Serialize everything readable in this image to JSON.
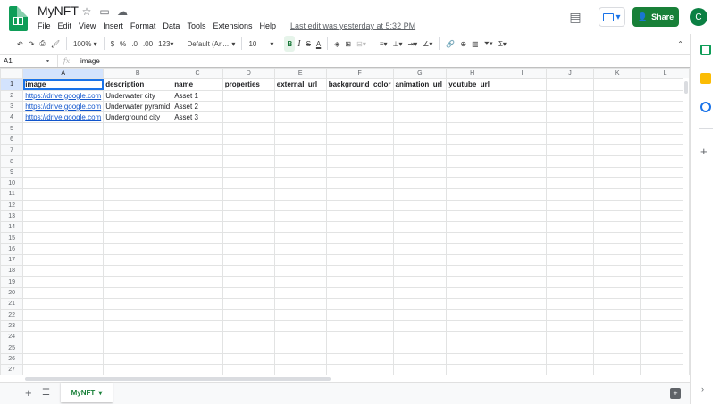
{
  "header": {
    "doc_title": "MyNFT",
    "menus": [
      "File",
      "Edit",
      "View",
      "Insert",
      "Format",
      "Data",
      "Tools",
      "Extensions",
      "Help"
    ],
    "last_edit": "Last edit was yesterday at 5:32 PM",
    "share_label": "Share",
    "avatar_letter": "C"
  },
  "toolbar": {
    "zoom": "100%",
    "currency": "$",
    "percent": "%",
    "decrease_decimal": ".0",
    "increase_decimal": ".00",
    "more_formats": "123",
    "font": "Default (Ari...",
    "font_size": "10",
    "bold": "B",
    "italic": "I",
    "strike": "S",
    "text_color": "A"
  },
  "formula_bar": {
    "cell_ref": "A1",
    "fx": "fx",
    "value": "image"
  },
  "sheet": {
    "columns": [
      "A",
      "B",
      "C",
      "D",
      "E",
      "F",
      "G",
      "H",
      "I",
      "J",
      "K",
      "L"
    ],
    "row_count": 27,
    "rows": [
      [
        "image",
        "description",
        "name",
        "properties",
        "external_url",
        "background_color",
        "animation_url",
        "youtube_url"
      ],
      [
        "https://drive.google.com",
        "Underwater city",
        "Asset 1"
      ],
      [
        "https://drive.google.com",
        "Underwater pyramid",
        "Asset 2"
      ],
      [
        "https://drive.google.com",
        "Underground city",
        "Asset 3"
      ]
    ]
  },
  "bottom": {
    "sheet_tab": "MyNFT"
  },
  "colors": {
    "accent": "#1a73e8",
    "share_green": "#188038",
    "logo_green": "#0f9d58",
    "link": "#1155cc"
  }
}
